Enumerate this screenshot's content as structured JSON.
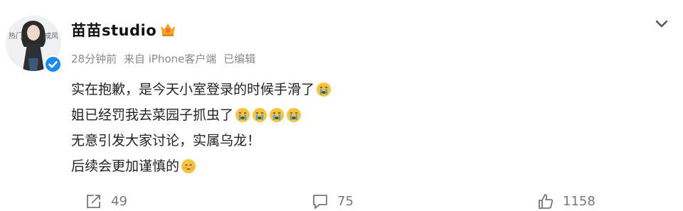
{
  "post": {
    "username": "苗苗studio",
    "time_ago": "28分钟前",
    "source": "来自 iPhone客户端",
    "edited": "已编辑",
    "avatar_text": "热门成风",
    "lines": [
      "实在抱歉，是今天小室登录的时候手滑了",
      "姐已经罚我去菜园子抓虫了",
      "无意引发大家讨论，实属乌龙！",
      "后续会更加谨慎的"
    ],
    "emoji": {
      "line1": "crying-face-icon",
      "line2": [
        "crying-face-icon",
        "crying-face-icon",
        "crying-face-icon",
        "crying-face-icon"
      ],
      "line4": "flushed-face-icon"
    },
    "counts": {
      "reposts": "49",
      "comments": "75",
      "likes": "1158"
    }
  },
  "colors": {
    "verified_blue": "#1a8cf0",
    "meta_gray": "#8a8a8a",
    "emoji_yellow": "#f7c43b",
    "tear_blue": "#4aa6e8"
  }
}
